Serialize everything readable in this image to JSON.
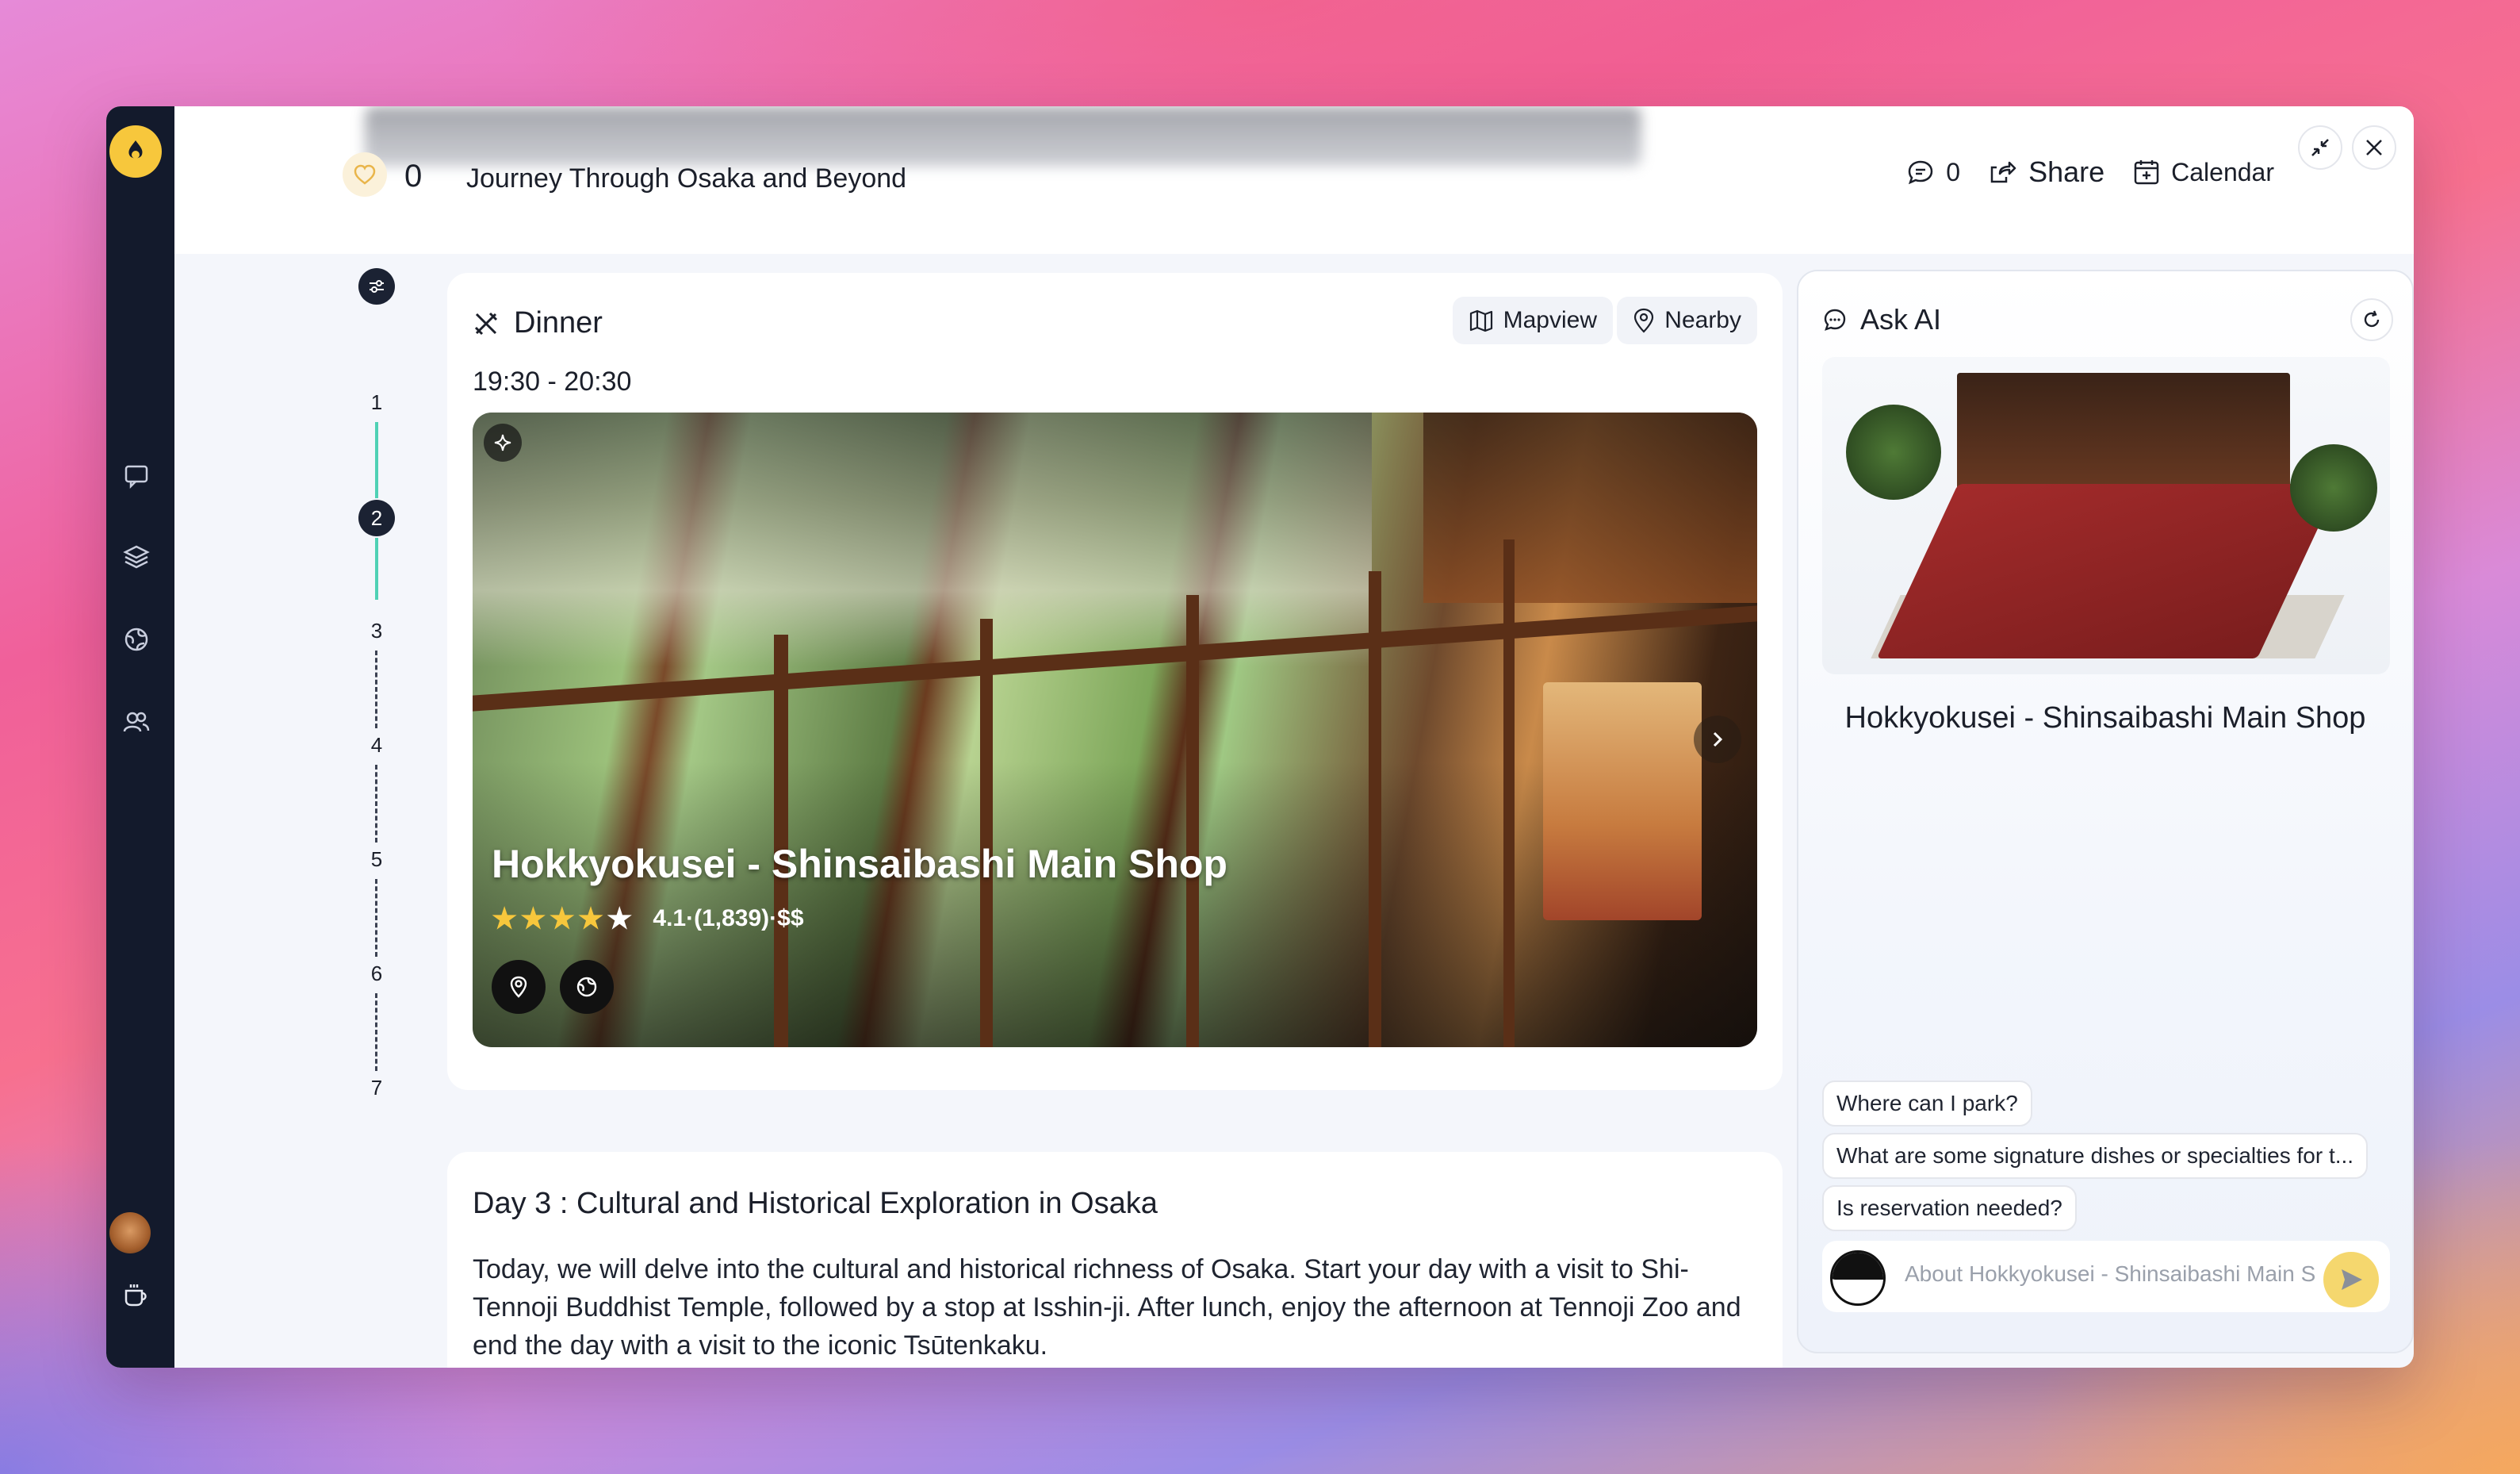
{
  "header": {
    "like_count": "0",
    "trip_title": "Journey Through Osaka and Beyond",
    "comments_count": "0",
    "share_label": "Share",
    "calendar_label": "Calendar"
  },
  "timeline": {
    "steps": [
      "1",
      "2",
      "3",
      "4",
      "5",
      "6",
      "7"
    ],
    "active_step": "2"
  },
  "activity": {
    "category": "Dinner",
    "time": "19:30 - 20:30",
    "mapview_label": "Mapview",
    "nearby_label": "Nearby",
    "place_name": "Hokkyokusei - Shinsaibashi Main Shop",
    "rating": 4.1,
    "stars_filled": 4,
    "stars_total": 5,
    "meta_text": "4.1·(1,839)·$$"
  },
  "day": {
    "title": "Day 3 : Cultural and Historical Exploration in Osaka",
    "description": "Today, we will delve into the cultural and historical richness of Osaka. Start your day with a visit to Shi-Tennoji Buddhist Temple, followed by a stop at Isshin-ji. After lunch, enjoy the afternoon at Tennoji Zoo and end the day with a visit to the iconic Tsūtenkaku."
  },
  "ask_ai": {
    "title": "Ask AI",
    "place_name": "Hokkyokusei - Shinsaibashi Main Shop",
    "suggestions": [
      "Is reservation needed?",
      "What are some signature dishes or specialties for t...",
      "Where can I park?"
    ],
    "input_placeholder": "About Hokkyokusei - Shinsaibashi Main S"
  },
  "colors": {
    "accent_yellow": "#f7c73c",
    "rail_bg": "#131a2c",
    "timeline_done": "#4fd1b5",
    "star": "#f7c73c"
  }
}
